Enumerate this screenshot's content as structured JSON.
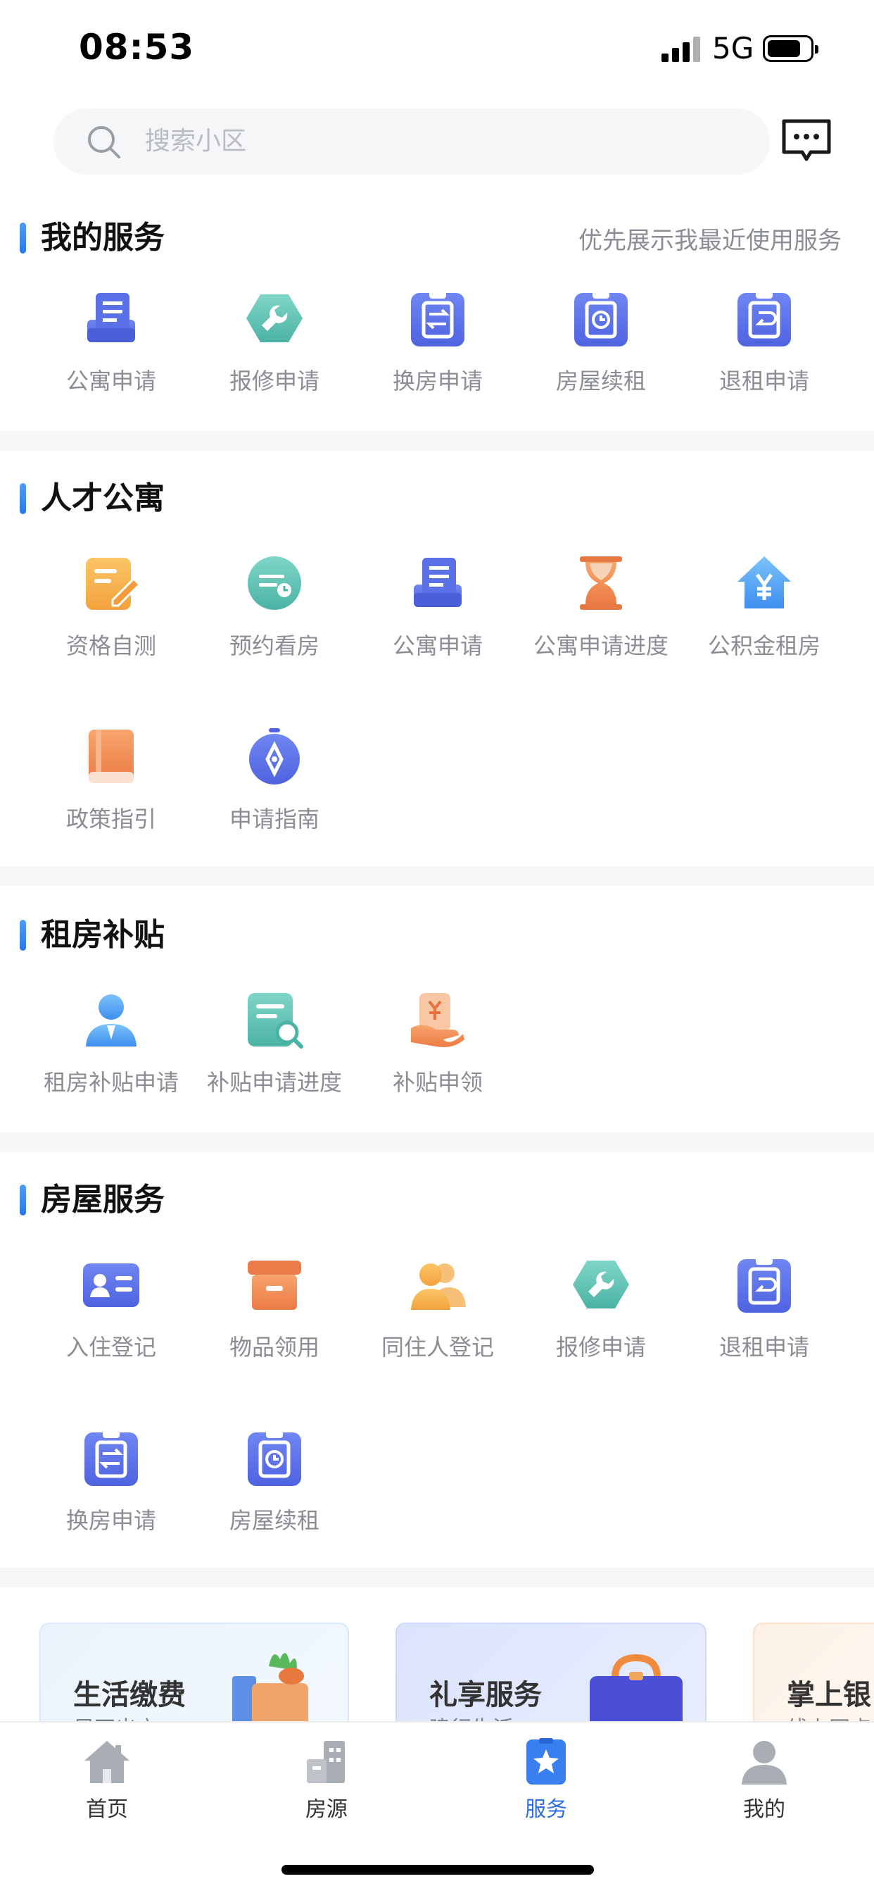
{
  "status_bar": {
    "time": "08:53",
    "network": "5G"
  },
  "search": {
    "placeholder": "搜索小区"
  },
  "colors": {
    "accent": "#2f6fe6",
    "section_bar": "#3b86f2"
  },
  "sections": {
    "my_services": {
      "title": "我的服务",
      "hint": "优先展示我最近使用服务",
      "items": [
        {
          "label": "公寓申请",
          "icon": "apartment-form-icon"
        },
        {
          "label": "报修申请",
          "icon": "wrench-icon"
        },
        {
          "label": "换房申请",
          "icon": "swap-clipboard-icon"
        },
        {
          "label": "房屋续租",
          "icon": "clock-clipboard-icon"
        },
        {
          "label": "退租申请",
          "icon": "return-clipboard-icon"
        }
      ]
    },
    "talent": {
      "title": "人才公寓",
      "items": [
        {
          "label": "资格自测",
          "icon": "edit-note-icon"
        },
        {
          "label": "预约看房",
          "icon": "schedule-icon"
        },
        {
          "label": "公寓申请",
          "icon": "apartment-form-icon"
        },
        {
          "label": "公寓申请进度",
          "icon": "hourglass-icon"
        },
        {
          "label": "公积金租房",
          "icon": "yuan-house-icon"
        },
        {
          "label": "政策指引",
          "icon": "book-icon"
        },
        {
          "label": "申请指南",
          "icon": "compass-icon"
        }
      ]
    },
    "subsidy": {
      "title": "租房补贴",
      "items": [
        {
          "label": "租房补贴申请",
          "icon": "person-icon"
        },
        {
          "label": "补贴申请进度",
          "icon": "doc-search-icon"
        },
        {
          "label": "补贴申领",
          "icon": "yuan-hand-icon"
        }
      ]
    },
    "housing": {
      "title": "房屋服务",
      "items": [
        {
          "label": "入住登记",
          "icon": "id-card-icon"
        },
        {
          "label": "物品领用",
          "icon": "box-icon"
        },
        {
          "label": "同住人登记",
          "icon": "people-icon"
        },
        {
          "label": "报修申请",
          "icon": "wrench-icon"
        },
        {
          "label": "退租申请",
          "icon": "return-clipboard-icon"
        },
        {
          "label": "换房申请",
          "icon": "swap-clipboard-icon"
        },
        {
          "label": "房屋续租",
          "icon": "clock-clipboard-icon"
        }
      ]
    }
  },
  "promos": [
    {
      "title": "生活缴费",
      "subtitle": "足不出户"
    },
    {
      "title": "礼享服务",
      "subtitle": "建行生活"
    },
    {
      "title": "掌上银",
      "subtitle": "线上网点"
    }
  ],
  "tabs": [
    {
      "label": "首页",
      "icon": "home-icon"
    },
    {
      "label": "房源",
      "icon": "building-icon"
    },
    {
      "label": "服务",
      "icon": "star-service-icon",
      "active": true
    },
    {
      "label": "我的",
      "icon": "user-icon"
    }
  ]
}
